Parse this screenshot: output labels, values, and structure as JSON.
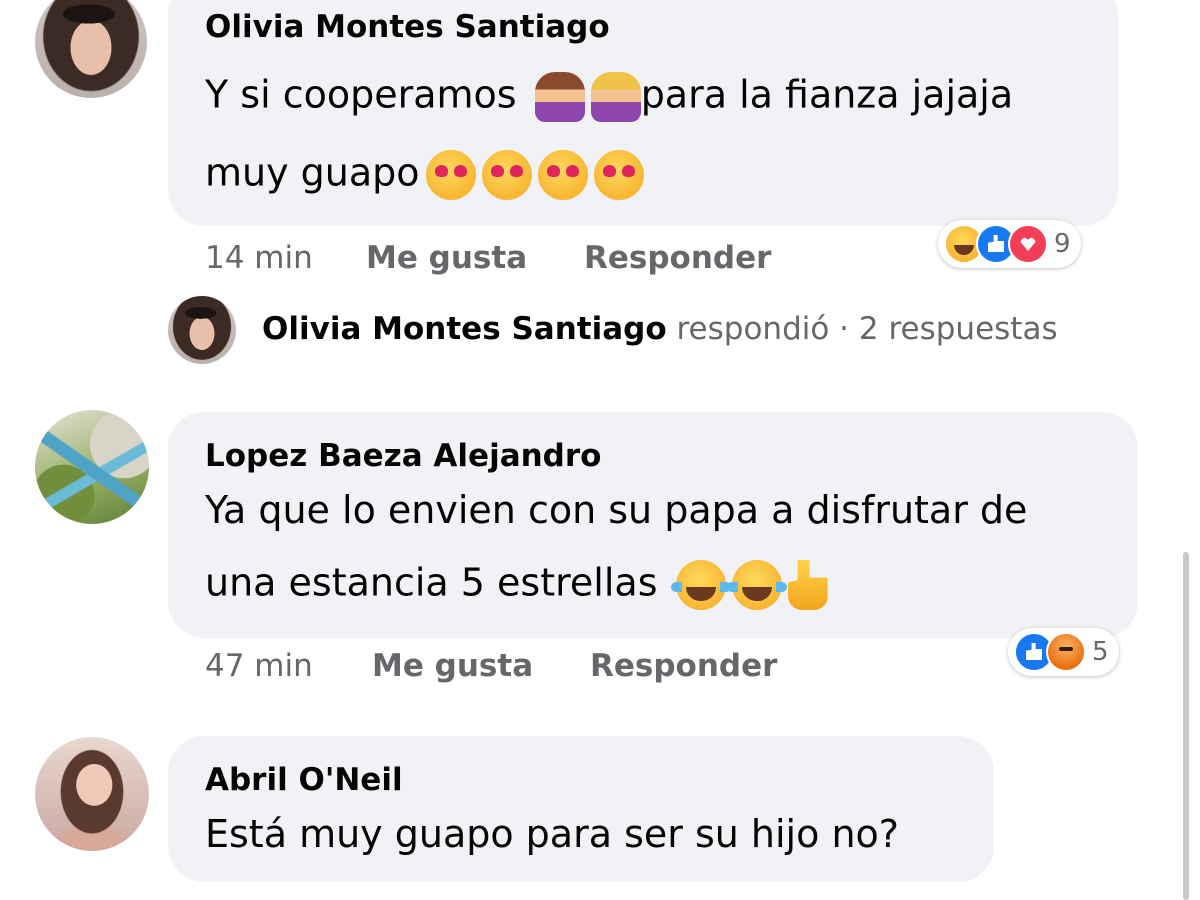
{
  "comments": [
    {
      "author": "Olivia Montes Santiago",
      "line1": "Y si cooperamos",
      "line1b": "para la fianza jajaja",
      "line2": "muy guapo",
      "time": "14 min",
      "like_label": "Me gusta",
      "reply_label": "Responder",
      "reaction_count": "9",
      "reactions": [
        "haha-icon",
        "like-icon",
        "love-icon"
      ],
      "emojis_line1": [
        "woman-shrugging-emoji",
        "woman-facepalming-emoji"
      ],
      "emojis_line2": [
        "heart-eyes-emoji",
        "heart-eyes-emoji",
        "heart-eyes-emoji",
        "heart-eyes-emoji"
      ]
    },
    {
      "author": "Lopez Baeza Alejandro",
      "line1": "Ya que lo envien con su papa a disfrutar de",
      "line2": "una estancia 5 estrellas",
      "time": "47 min",
      "like_label": "Me gusta",
      "reply_label": "Responder",
      "reaction_count": "5",
      "reactions": [
        "like-icon",
        "angry-icon"
      ],
      "emojis_line2": [
        "tears-of-joy-emoji",
        "tears-of-joy-emoji",
        "thumbs-up-emoji"
      ]
    },
    {
      "author": "Abril O'Neil",
      "line1": "Está muy guapo para ser su hijo no?"
    }
  ],
  "reply_summary": {
    "author": "Olivia Montes Santiago",
    "text": "respondió · 2 respuestas"
  },
  "colors": {
    "bubble": "#f0f2f5",
    "meta_text": "#65676b",
    "like_blue": "#1877f2",
    "love_red": "#f33e58"
  }
}
